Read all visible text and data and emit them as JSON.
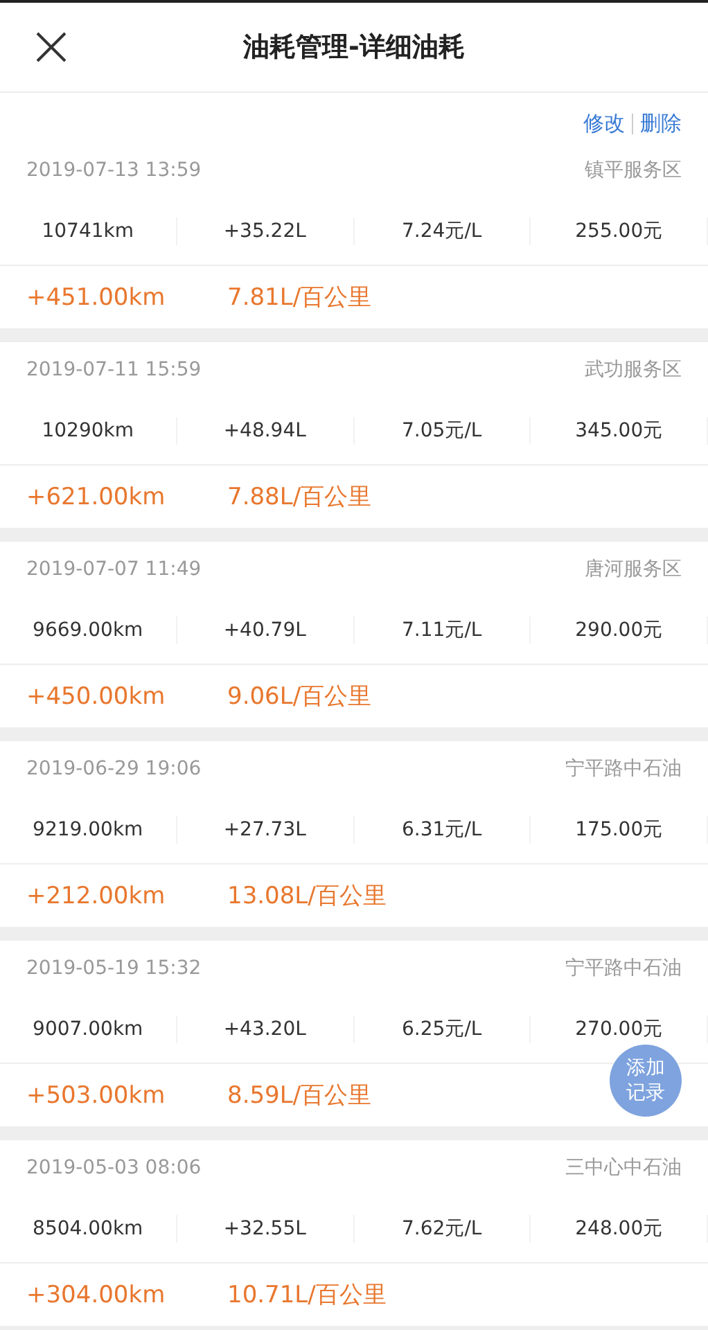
{
  "header": {
    "title": "油耗管理-详细油耗"
  },
  "actions": [
    "修改",
    "删除"
  ],
  "records": [
    {
      "time": "2019-07-13 13:59",
      "place": "镇平服务区",
      "odometer": "10741km",
      "fuel": "+35.22L",
      "price": "7.24元/L",
      "cost": "255.00元",
      "distance": "+451.00km",
      "consumption": "7.81L/百公里"
    },
    {
      "time": "2019-07-11 15:59",
      "place": "武功服务区",
      "odometer": "10290km",
      "fuel": "+48.94L",
      "price": "7.05元/L",
      "cost": "345.00元",
      "distance": "+621.00km",
      "consumption": "7.88L/百公里"
    },
    {
      "time": "2019-07-07 11:49",
      "place": "唐河服务区",
      "odometer": "9669.00km",
      "fuel": "+40.79L",
      "price": "7.11元/L",
      "cost": "290.00元",
      "distance": "+450.00km",
      "consumption": "9.06L/百公里"
    },
    {
      "time": "2019-06-29 19:06",
      "place": "宁平路中石油",
      "odometer": "9219.00km",
      "fuel": "+27.73L",
      "price": "6.31元/L",
      "cost": "175.00元",
      "distance": "+212.00km",
      "consumption": "13.08L/百公里"
    },
    {
      "time": "2019-05-19 15:32",
      "place": "宁平路中石油",
      "odometer": "9007.00km",
      "fuel": "+43.20L",
      "price": "6.25元/L",
      "cost": "270.00元",
      "distance": "+503.00km",
      "consumption": "8.59L/百公里"
    },
    {
      "time": "2019-05-03 08:06",
      "place": "三中心中石油",
      "odometer": "8504.00km",
      "fuel": "+32.55L",
      "price": "7.62元/L",
      "cost": "248.00元",
      "distance": "+304.00km",
      "consumption": "10.71L/百公里"
    }
  ],
  "add_button": {
    "lines": [
      "添加",
      "记录"
    ]
  }
}
